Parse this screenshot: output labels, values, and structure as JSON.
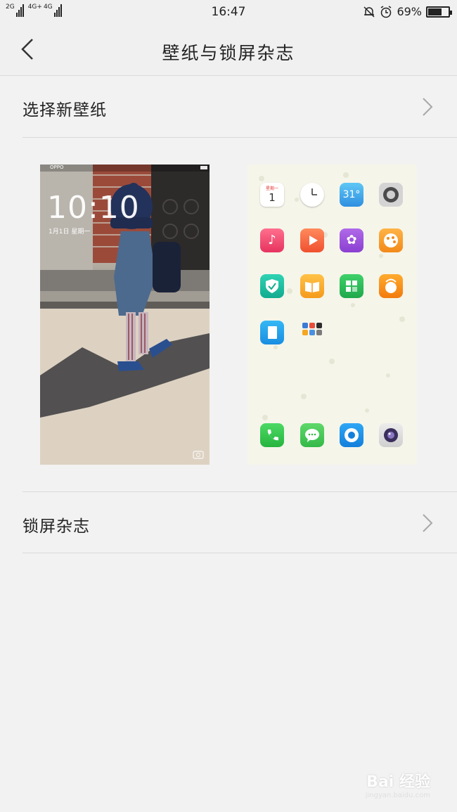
{
  "status_bar": {
    "network_1": "2G",
    "network_2": "4G+",
    "network_3": "4G",
    "time": "16:47",
    "battery_percent": "69%",
    "battery_level": 0.69
  },
  "header": {
    "title": "壁纸与锁屏杂志"
  },
  "list": {
    "choose_wallpaper": "选择新壁纸",
    "lock_screen_magazine": "锁屏杂志"
  },
  "lock_preview": {
    "carrier": "OPPO",
    "clock": "10:10",
    "date": "1月1日  星期一"
  },
  "home_preview": {
    "calendar_weekday": "星期一",
    "calendar_day": "1",
    "weather_temp": "31°"
  },
  "watermark": {
    "text": "Bai 经验",
    "url": "jingyan.baidu.com"
  }
}
